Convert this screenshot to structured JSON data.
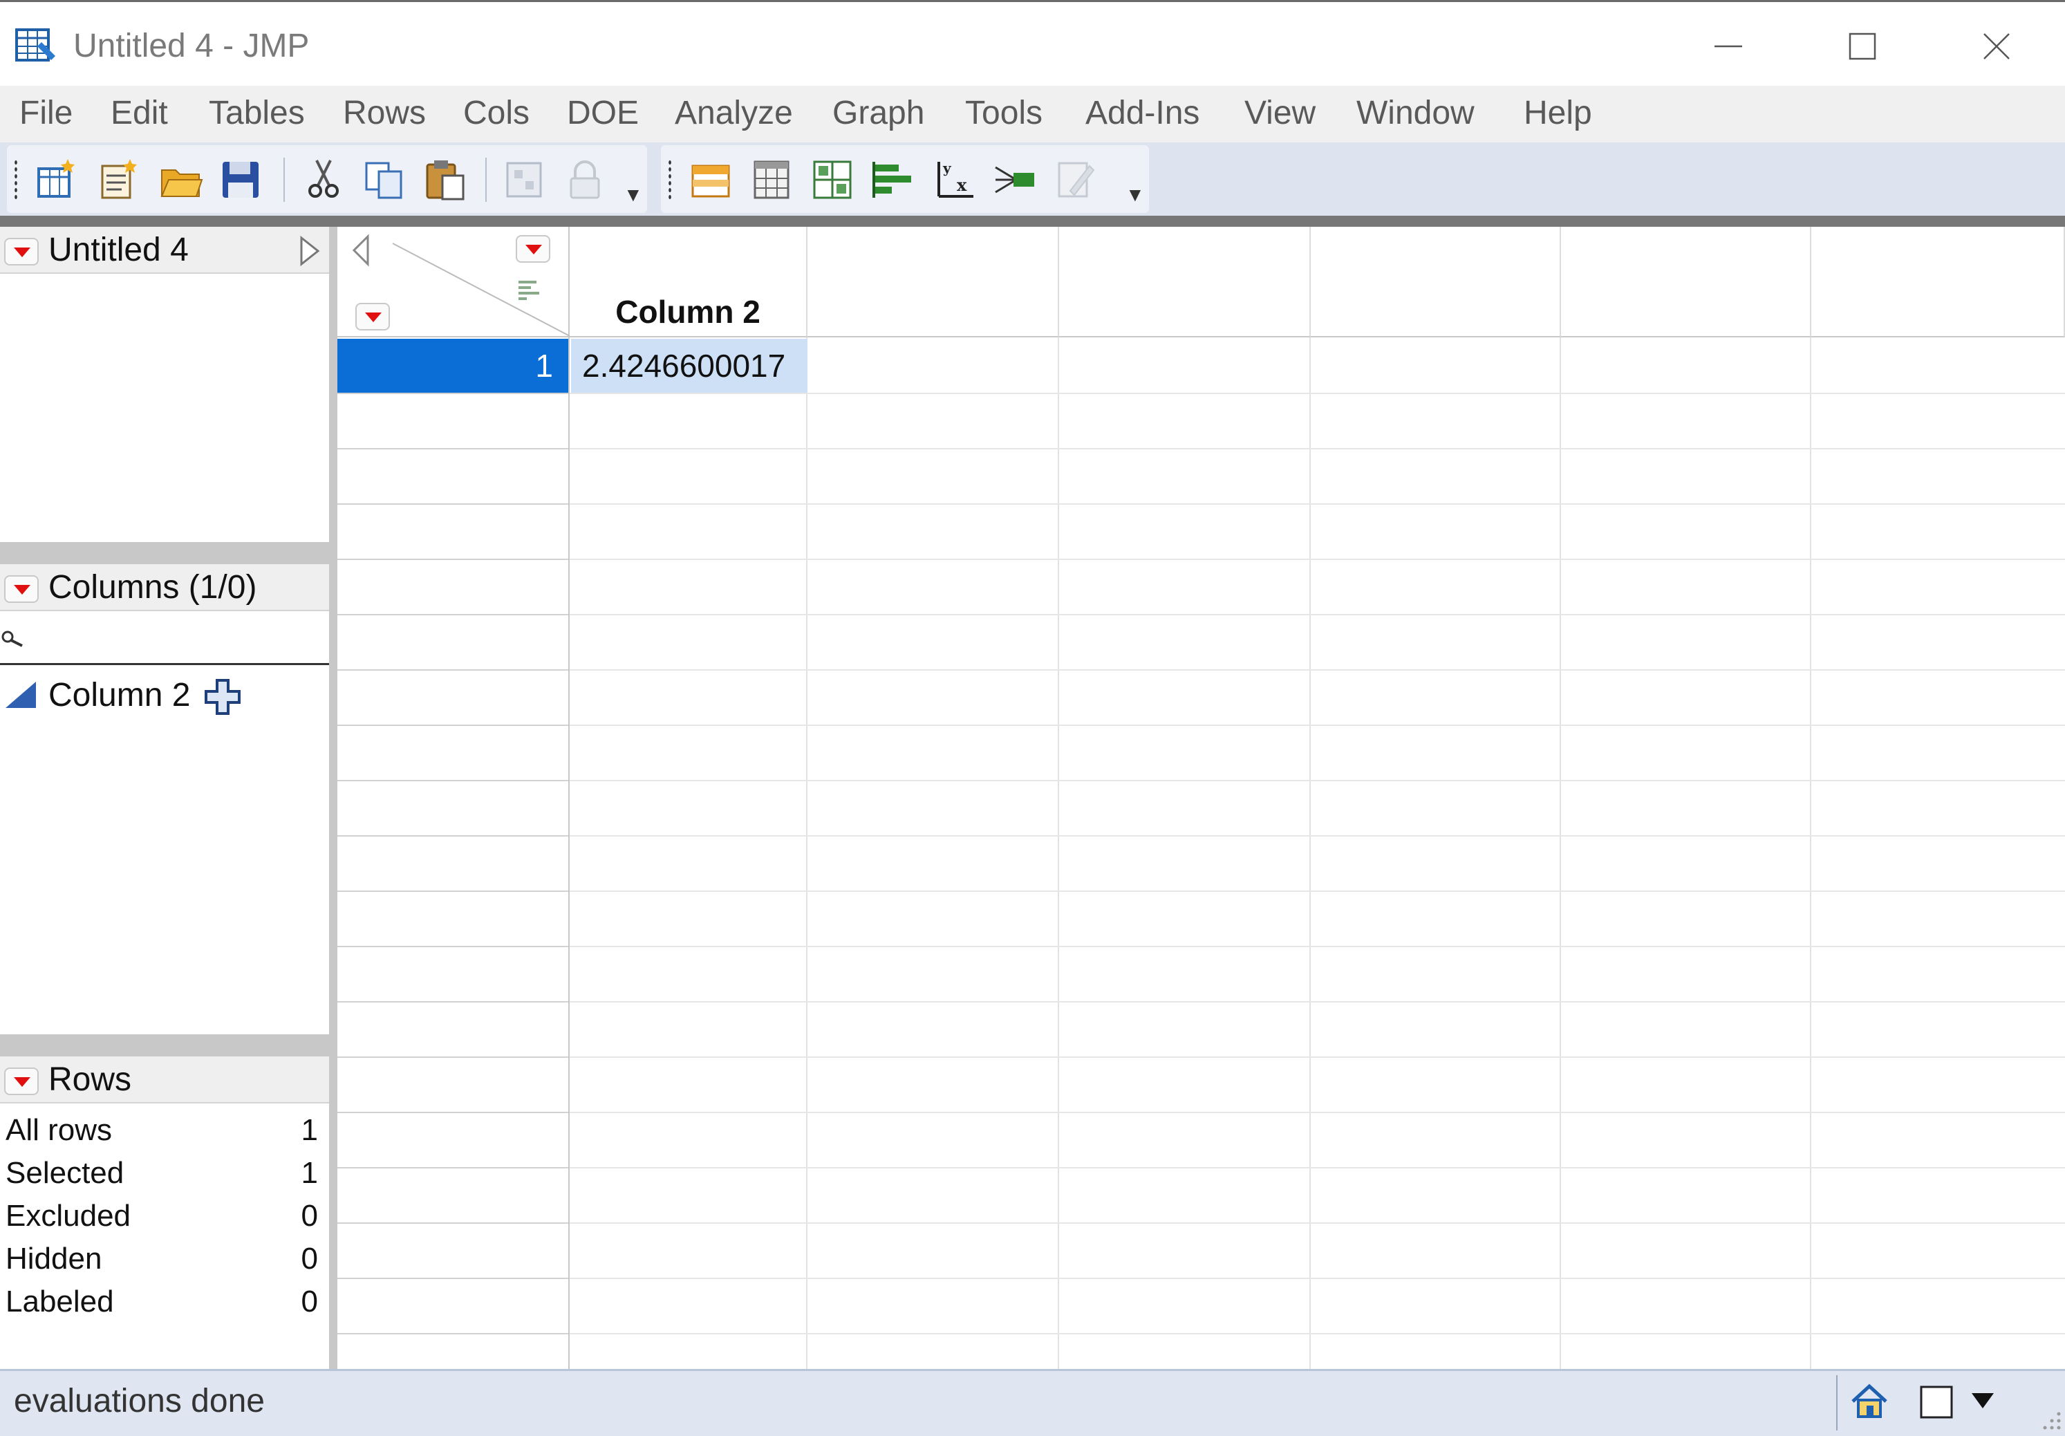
{
  "window": {
    "title": "Untitled 4 - JMP",
    "minimize_glyph": "minimize",
    "maximize_glyph": "maximize",
    "close_glyph": "close"
  },
  "menu": [
    "File",
    "Edit",
    "Tables",
    "Rows",
    "Cols",
    "DOE",
    "Analyze",
    "Graph",
    "Tools",
    "Add-Ins",
    "View",
    "Window",
    "Help"
  ],
  "toolbar": {
    "group1_icons": [
      "new-data-table-icon",
      "new-script-icon",
      "open-icon",
      "save-icon",
      "cut-icon",
      "copy-icon",
      "paste-icon",
      "group-icon",
      "lock-icon"
    ],
    "group2_icons": [
      "subset-icon",
      "summary-icon",
      "tabulate-icon",
      "distribution-icon",
      "fit-y-by-x-icon",
      "fit-model-icon",
      "edit-script-icon"
    ]
  },
  "table_panel": {
    "title": "Untitled 4"
  },
  "columns_panel": {
    "title": "Columns (1/0)",
    "items": [
      {
        "name": "Column 2"
      }
    ]
  },
  "rows_panel": {
    "title": "Rows",
    "stats": [
      {
        "label": "All rows",
        "value": "1"
      },
      {
        "label": "Selected",
        "value": "1"
      },
      {
        "label": "Excluded",
        "value": "0"
      },
      {
        "label": "Hidden",
        "value": "0"
      },
      {
        "label": "Labeled",
        "value": "0"
      }
    ]
  },
  "grid": {
    "columns": [
      "Column 2"
    ],
    "rows": [
      {
        "row_number": "1",
        "values": [
          "2.4246600017"
        ]
      }
    ]
  },
  "status": {
    "text": "evaluations done"
  },
  "colors": {
    "selection_blue": "#0a6ed6",
    "selected_cell": "#cde0f5",
    "red_triangle": "#e01010",
    "toolbar_bg": "#dde3ef"
  }
}
